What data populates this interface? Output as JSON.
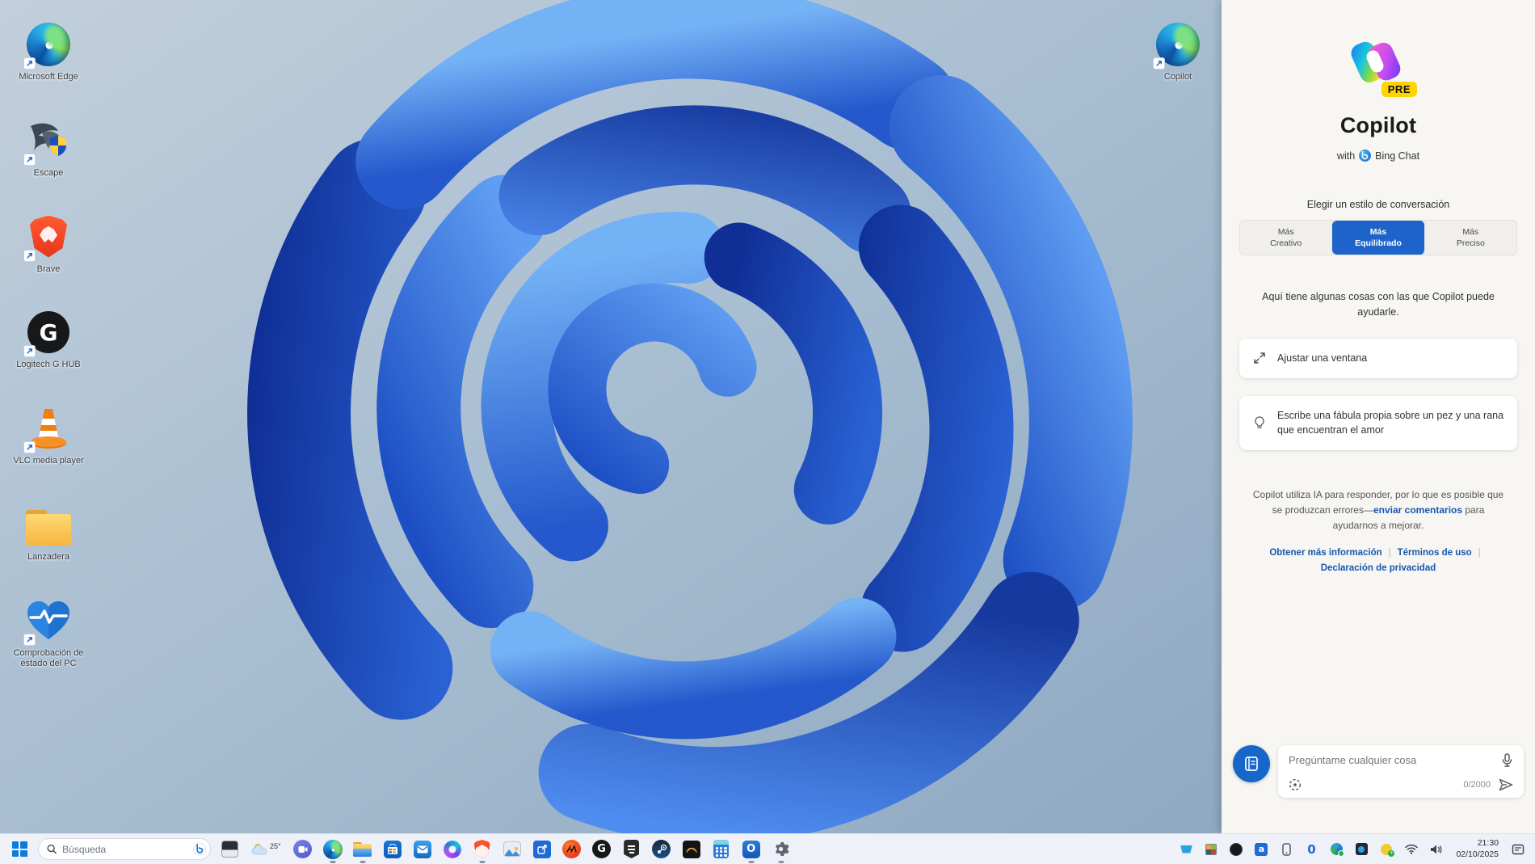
{
  "desktop": {
    "icons": [
      {
        "label": "Microsoft Edge",
        "icon": "edge-icon"
      },
      {
        "label": "Escape",
        "icon": "bird-shield-icon"
      },
      {
        "label": "Brave",
        "icon": "brave-icon"
      },
      {
        "label": "Logitech G HUB",
        "icon": "logitech-g-icon"
      },
      {
        "label": "VLC media player",
        "icon": "vlc-cone-icon"
      },
      {
        "label": "Lanzadera",
        "icon": "folder-icon"
      },
      {
        "label": "Comprobación de estado del PC",
        "icon": "pc-health-heart-icon"
      }
    ],
    "top_right_icon": {
      "label": "Copilot",
      "icon": "edge-icon"
    }
  },
  "copilot_panel": {
    "logo_badge": "PRE",
    "title": "Copilot",
    "subtitle_prefix": "with",
    "subtitle_brand": "Bing Chat",
    "style_heading": "Elegir un estilo de conversación",
    "styles": [
      {
        "line1": "Más",
        "line2": "Creativo",
        "selected": false
      },
      {
        "line1": "Más",
        "line2": "Equilibrado",
        "selected": true
      },
      {
        "line1": "Más",
        "line2": "Preciso",
        "selected": false
      }
    ],
    "intro": "Aquí tiene algunas cosas con las que Copilot puede ayudarle.",
    "suggestions": [
      {
        "label": "Ajustar una ventana",
        "icon": "adjust-window-icon"
      },
      {
        "label": "Escribe una fábula propia sobre un pez y una rana que encuentran el amor",
        "icon": "lightbulb-icon"
      }
    ],
    "disclaimer": {
      "part1": "Copilot utiliza IA para responder, por lo que es posible que se produzcan errores—",
      "link": "enviar comentarios",
      "part2": " para ayudarnos a mejorar."
    },
    "footer_links": [
      "Obtener más información",
      "Términos de uso",
      "Declaración de privacidad"
    ],
    "input": {
      "placeholder": "Pregúntame cualquier cosa",
      "char_count": "0/2000"
    }
  },
  "taskbar": {
    "search": {
      "placeholder": "Búsqueda"
    },
    "weather": {
      "temp": "25°"
    },
    "pinned_icons": [
      "start",
      "search",
      "task-view",
      "weather",
      "chat",
      "edge",
      "file-explorer",
      "microsoft-store",
      "mail",
      "microsoft-365",
      "brave",
      "photos",
      "shortcut-app",
      "ea-app",
      "logitech-ghub",
      "epic-games",
      "steam",
      "battle-net",
      "calculator",
      "outlook",
      "settings"
    ],
    "running_icons": [
      "edge",
      "file-explorer",
      "brave",
      "outlook",
      "settings"
    ],
    "tray_icons": [
      "cup",
      "gallery",
      "ghub",
      "app-a",
      "phone-link",
      "zero",
      "security-globe",
      "capture",
      "antivirus",
      "wifi",
      "volume",
      "notifications"
    ],
    "icon_glyphs": {
      "ghub": "G",
      "ghub_tray": "G",
      "outlook": "O",
      "tray_a": "a",
      "tray_zero": "0"
    },
    "clock": {
      "time": "21:30",
      "date": "02/10/2025"
    }
  },
  "colors": {
    "accent_blue": "#1d63c9",
    "link_blue": "#1757ad",
    "pre_badge_bg": "#ffd400",
    "panel_bg": "#f7f6f3",
    "taskbar_bg": "#eef1f8",
    "wallpaper_blue": "#2563d8"
  }
}
